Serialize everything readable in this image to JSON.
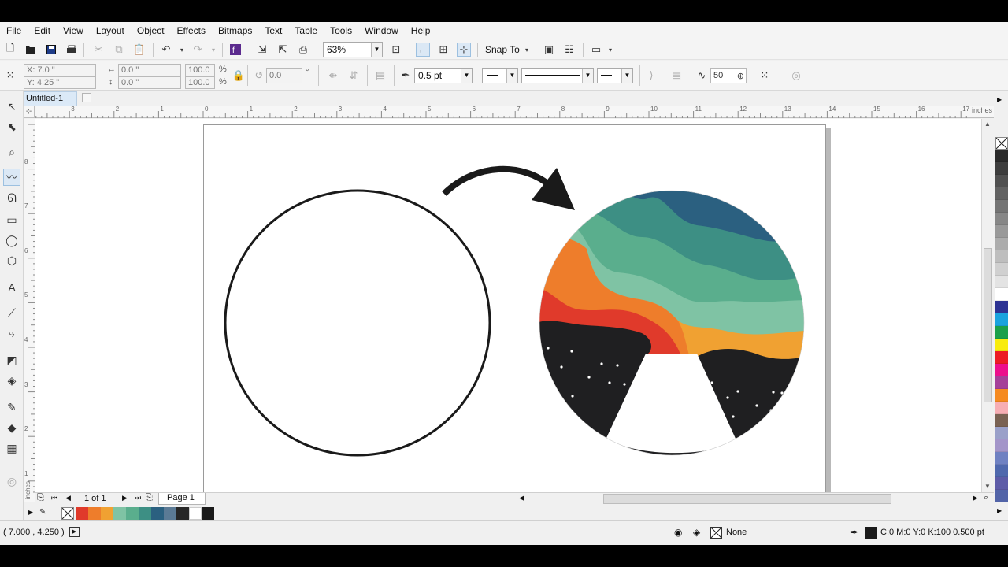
{
  "menu": [
    "File",
    "Edit",
    "View",
    "Layout",
    "Object",
    "Effects",
    "Bitmaps",
    "Text",
    "Table",
    "Tools",
    "Window",
    "Help"
  ],
  "toolbar": {
    "zoom": "63%",
    "snap_to": "Snap To"
  },
  "property_bar": {
    "x": "X: 7.0 \"",
    "y": "Y: 4.25 \"",
    "width": "0.0 \"",
    "height": "0.0 \"",
    "scale_x": "100.0",
    "scale_y": "100.0",
    "percent": "%",
    "rotation": "0.0",
    "degree": "°",
    "outline_width": "0.5 pt",
    "smoothing": "50"
  },
  "document": {
    "tab_title": "Untitled-1",
    "page_count": "1 of 1",
    "page_tab": "Page 1",
    "ruler_unit": "inches"
  },
  "ruler_h_labels": [
    "3",
    "2",
    "1",
    "0",
    "1",
    "2",
    "3",
    "4",
    "5",
    "6",
    "7",
    "8",
    "9",
    "10",
    "11",
    "12",
    "13",
    "14",
    "15",
    "16",
    "17"
  ],
  "ruler_v_labels": [
    "8",
    "7",
    "6",
    "5",
    "4",
    "3",
    "2",
    "1"
  ],
  "status": {
    "cursor_position": "( 7.000 , 4.250  )",
    "fill": "None",
    "outline_color": "C:0 M:0 Y:0 K:100  0.500 pt"
  },
  "document_palette": [
    "#e03a2b",
    "#ee7d2b",
    "#f0a132",
    "#7fc3a4",
    "#5aae8d",
    "#3d8f84",
    "#2b6080",
    "#5b7a95",
    "#262626",
    "#ffffff",
    "#1a1a1a"
  ],
  "color_palette": [
    "#2a2a2a",
    "#3d3d3d",
    "#505050",
    "#626262",
    "#747474",
    "#878787",
    "#999999",
    "#acacac",
    "#bebebe",
    "#d0d0d0",
    "#e3e3e3",
    "#ffffff",
    "#2d3393",
    "#1aa3de",
    "#1ba04a",
    "#f8ec0d",
    "#ec1c24",
    "#ec0f8c",
    "#a54099",
    "#f58a20",
    "#f7aeb4",
    "#7a6253",
    "#9aa0c9",
    "#a395c9",
    "#6f81c2",
    "#4f68ad",
    "#5d5ba7",
    "#5264a8"
  ],
  "artwork_colors": {
    "dark_blue": "#2b6080",
    "teal": "#3d8f84",
    "green": "#5aae8d",
    "mint": "#7fc3a4",
    "orange": "#ee7d2b",
    "amber": "#f0a132",
    "red": "#e03a2b",
    "night": "#1f1f21",
    "outline": "#1a1a1a"
  }
}
